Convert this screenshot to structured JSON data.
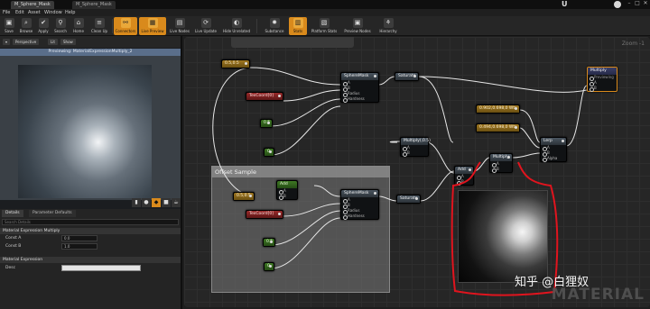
{
  "tabs": [
    "M_Sphere_Mask",
    "M_Sphere_Mask"
  ],
  "menu": [
    "File",
    "Edit",
    "Asset",
    "Window",
    "Help"
  ],
  "toolbar": [
    {
      "label": "Save",
      "icon": "save-icon"
    },
    {
      "label": "Browse",
      "icon": "browse-icon"
    },
    {
      "label": "Apply",
      "icon": "apply-icon"
    },
    {
      "label": "Search",
      "icon": "search-icon"
    },
    {
      "label": "Home",
      "icon": "home-icon"
    },
    {
      "label": "Clean Up",
      "icon": "cleanup-icon"
    },
    {
      "label": "Connectors",
      "icon": "connectors-icon",
      "active": true
    },
    {
      "label": "Live Preview",
      "icon": "live-preview-icon",
      "active": true
    },
    {
      "label": "Live Nodes",
      "icon": "live-nodes-icon"
    },
    {
      "label": "Live Update",
      "icon": "live-update-icon"
    },
    {
      "label": "Hide Unrelated",
      "icon": "hide-unrelated-icon"
    },
    {
      "label": "Substance",
      "icon": "substance-icon"
    },
    {
      "label": "Stats",
      "icon": "stats-icon",
      "active": true
    },
    {
      "label": "Platform Stats",
      "icon": "platform-stats-icon"
    },
    {
      "label": "Preview Nodes",
      "icon": "preview-nodes-icon"
    },
    {
      "label": "Hierarchy",
      "icon": "hierarchy-icon"
    }
  ],
  "viewport": {
    "buttons": [
      "Perspective",
      "Lit",
      "Show"
    ],
    "preview_label": "Previewing: MaterialExpressionMultiply_2"
  },
  "details": {
    "tabs": [
      "Details",
      "Parameter Defaults"
    ],
    "search_placeholder": "Search Details",
    "section1": "Material Expression Multiply",
    "const_a_label": "Const A",
    "const_a_value": "0.0",
    "const_b_label": "Const B",
    "const_b_value": "1.0",
    "section2": "Material Expression",
    "desc_label": "Desc",
    "desc_value": ""
  },
  "graph": {
    "zoom": "Zoom -1",
    "watermark": "MATERIAL",
    "credit": "知乎 @白狸奴",
    "comment_title": "Offset Sample"
  },
  "nodes": {
    "n1": "0.5,0.5",
    "texcoord1": "TexCoord[0]",
    "const1": "0.5",
    "const2": "0",
    "spheremask1": "SphereMask",
    "saturate1": "Saturate",
    "multiply_top": "Multiply(,0.5)",
    "color1": "0.902,0.698,0 Wtr",
    "color2": "0.494,0.698,0 Wtr",
    "lerp": "Lerp",
    "add1": "Add",
    "multiply2": "Multiply",
    "n2": "0.5,0.5",
    "add_inner": "Add",
    "texcoord2": "TexCoord[0]",
    "const3": "0.5",
    "const4": "0",
    "spheremask2": "SphereMask",
    "saturate2": "Saturate",
    "final_title": "Multiply",
    "final_sub": "Previewing"
  },
  "pins": {
    "spheremask": [
      "A",
      "B",
      "Radius",
      "Hardness"
    ],
    "ab": [
      "A",
      "B"
    ],
    "lerp": [
      "A",
      "B",
      "Alpha"
    ],
    "final": [
      "A",
      "B"
    ]
  }
}
